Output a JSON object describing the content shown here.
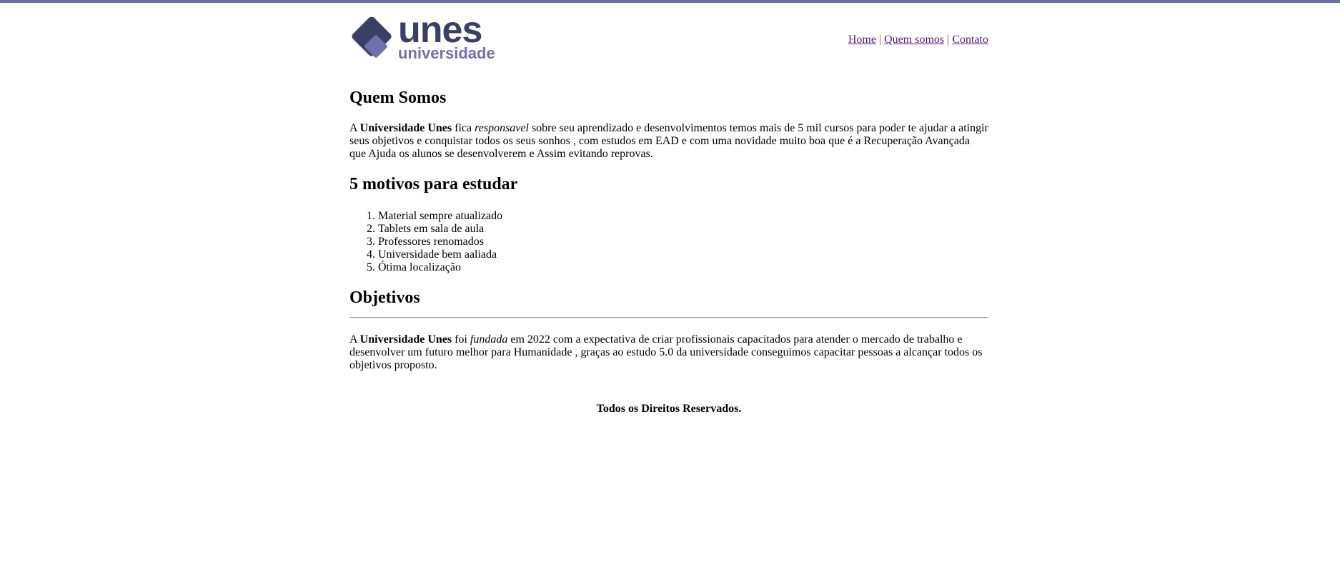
{
  "logo": {
    "brand": "unes",
    "subtitle": "universidade",
    "colors": {
      "dark": "#3a3f66",
      "light": "#6b72ad"
    }
  },
  "nav": {
    "home": "Home",
    "sep1": "|",
    "quem_somos": "Quem somos",
    "sep2": "|",
    "contato": "Contato"
  },
  "quem_somos": {
    "title": "Quem Somos",
    "p1": "A ",
    "bold": "Universidade Unes",
    "p2": " fica ",
    "italic": "responsavel",
    "p3": " sobre seu aprendizado e desenvolvimentos temos mais de 5 mil cursos para poder te ajudar a atingir seus objetivos e conquistar todos os seus sonhos , com estudos em EAD e com uma novidade muito boa que é a Recuperação Avançada que Ajuda os alunos se desenvolverem e Assim evitando reprovas."
  },
  "motivos": {
    "title": "5 motivos para estudar",
    "items": [
      "Material sempre atualizado",
      "Tablets em sala de aula",
      "Professores renomados",
      "Universidade bem aaliada",
      "Ótima localização"
    ]
  },
  "objetivos": {
    "title": "Objetivos",
    "p1": "A ",
    "bold": "Universidade Unes",
    "p2": " foi ",
    "italic": "fundada",
    "p3": " em 2022 com a expectativa de criar profissionais capacitados para atender o mercado de trabalho e desenvolver um futuro melhor para Humanidade , graças ao estudo 5.0 da universidade conseguimos capacitar pessoas a alcançar todos os objetivos proposto."
  },
  "footer": {
    "text": "Todos os Direitos Reservados."
  }
}
